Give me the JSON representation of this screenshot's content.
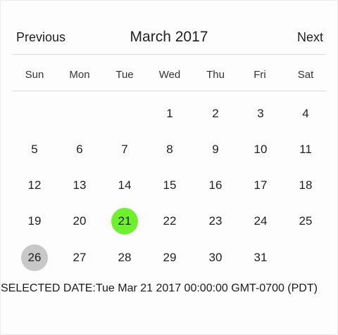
{
  "calendar": {
    "prev_label": "Previous",
    "next_label": "Next",
    "month_title": "March 2017",
    "weekdays": [
      "Sun",
      "Mon",
      "Tue",
      "Wed",
      "Thu",
      "Fri",
      "Sat"
    ],
    "weeks": [
      [
        "",
        "",
        "",
        "1",
        "2",
        "3",
        "4"
      ],
      [
        "5",
        "6",
        "7",
        "8",
        "9",
        "10",
        "11"
      ],
      [
        "12",
        "13",
        "14",
        "15",
        "16",
        "17",
        "18"
      ],
      [
        "19",
        "20",
        "21",
        "22",
        "23",
        "24",
        "25"
      ],
      [
        "26",
        "27",
        "28",
        "29",
        "30",
        "31",
        ""
      ]
    ],
    "selected_day": "21",
    "today_day": "26",
    "colors": {
      "selected": "#6ff02e",
      "today": "#c8c8c8"
    }
  },
  "status": {
    "selected_date_text": "SELECTED DATE:Tue Mar 21 2017 00:00:00 GMT-0700 (PDT)"
  }
}
